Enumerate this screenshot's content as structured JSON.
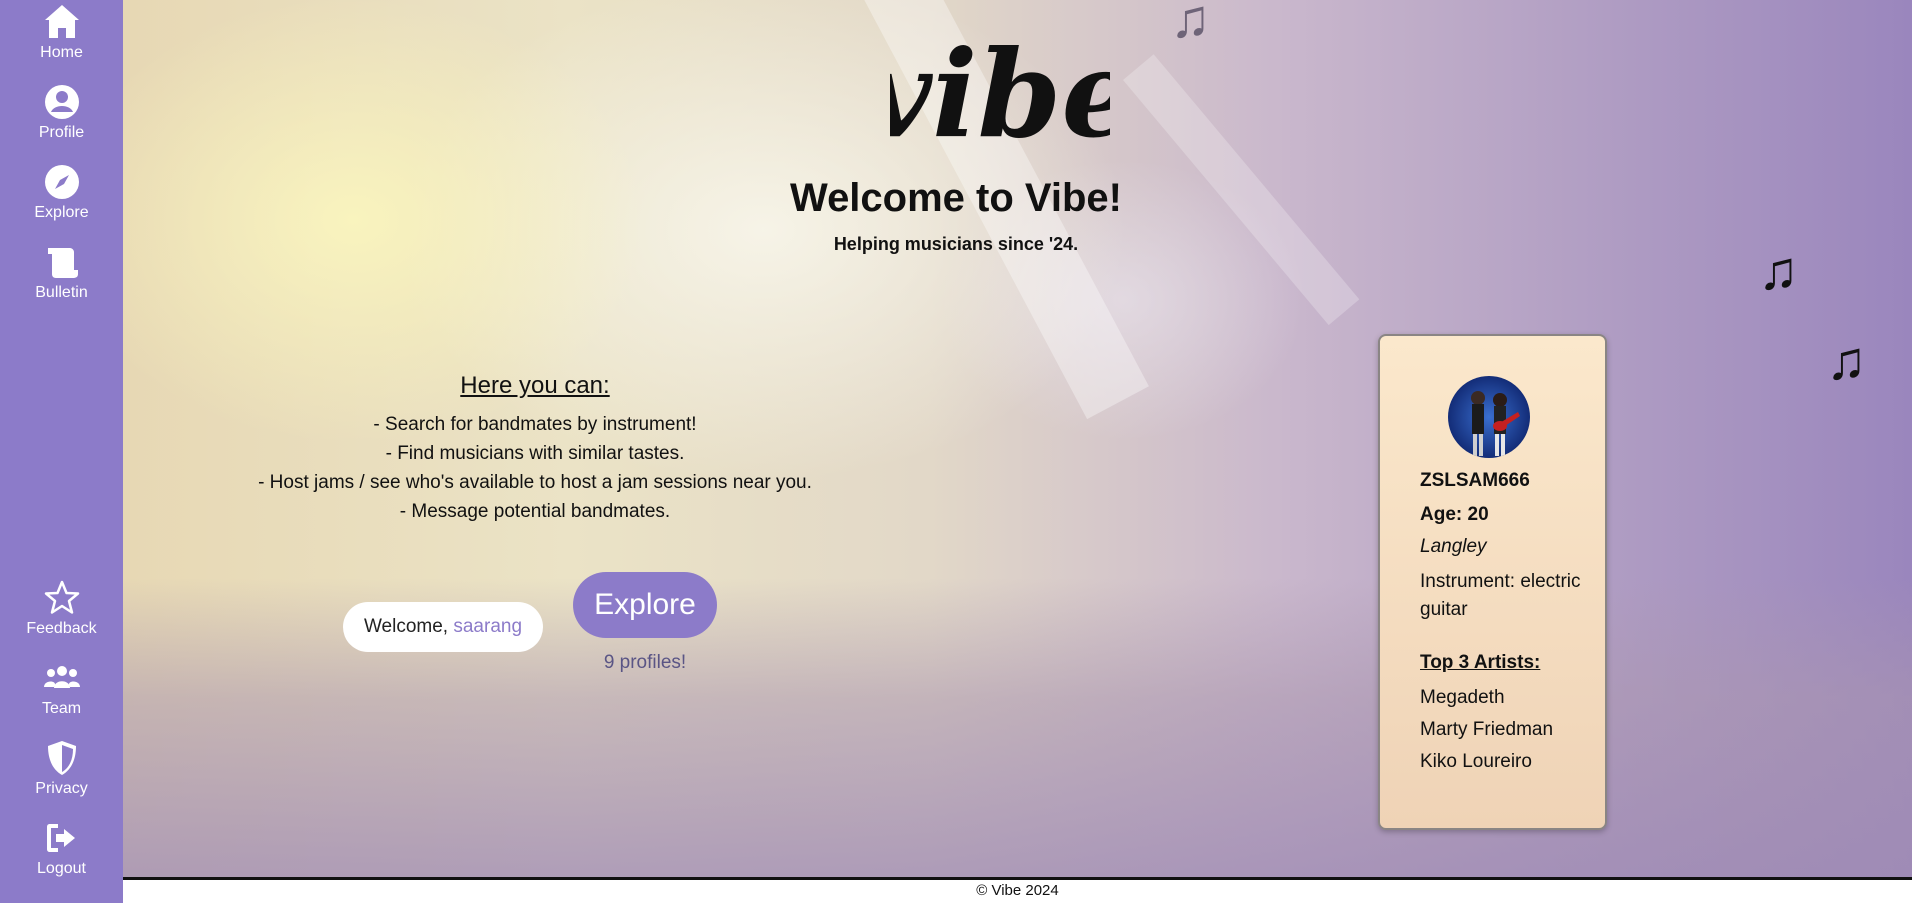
{
  "sidebar": {
    "top_items": [
      {
        "label": "Home",
        "icon": "home-icon"
      },
      {
        "label": "Profile",
        "icon": "user-circle-icon"
      },
      {
        "label": "Explore",
        "icon": "compass-icon"
      },
      {
        "label": "Bulletin",
        "icon": "scroll-icon"
      }
    ],
    "bottom_items": [
      {
        "label": "Feedback",
        "icon": "star-icon"
      },
      {
        "label": "Team",
        "icon": "people-icon"
      },
      {
        "label": "Privacy",
        "icon": "shield-icon"
      },
      {
        "label": "Logout",
        "icon": "logout-icon"
      }
    ]
  },
  "header": {
    "logo_text": "vibe",
    "title": "Welcome to Vibe!",
    "subtitle": "Helping musicians since '24."
  },
  "features": {
    "heading": "Here you can:",
    "items": [
      "- Search for bandmates by instrument!",
      "- Find musicians with similar tastes.",
      "- Host jams / see who's available to host a jam sessions near you.",
      "- Message potential bandmates."
    ]
  },
  "welcome": {
    "prefix": "Welcome,",
    "username": "saarang"
  },
  "explore": {
    "button_label": "Explore",
    "profiles_count": "9 profiles!"
  },
  "profile_card": {
    "username": "ZSLSAM666",
    "age": "Age: 20",
    "location": "Langley",
    "instrument": "Instrument: electric guitar",
    "artists_heading": "Top 3 Artists:",
    "artists": [
      "Megadeth",
      "Marty Friedman",
      "Kiko Loureiro"
    ]
  },
  "footer": {
    "text": "© Vibe 2024"
  },
  "colors": {
    "accent": "#8c7bc9",
    "card_bg": "#fbe8cc"
  }
}
